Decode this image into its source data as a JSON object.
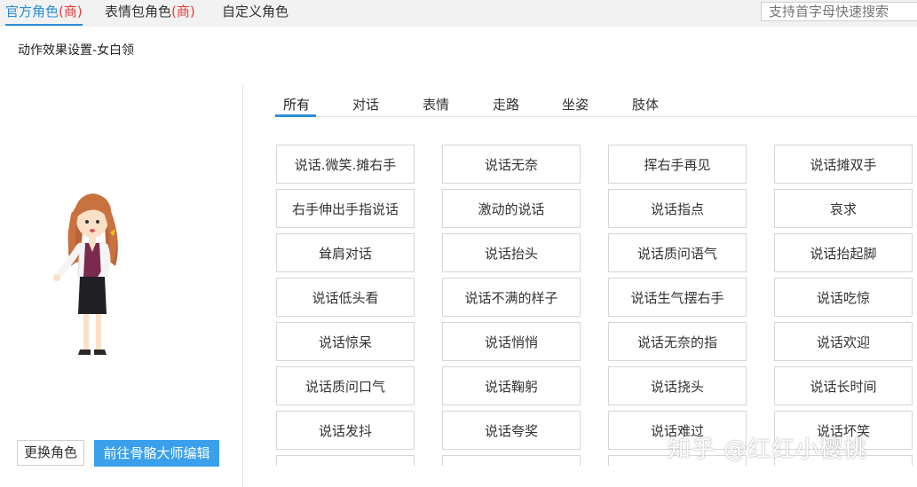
{
  "top_tabs": [
    {
      "label": "官方角色",
      "tag": "(商)",
      "active": true
    },
    {
      "label": "表情包角色",
      "tag": "(商)",
      "active": false
    },
    {
      "label": "自定义角色",
      "tag": "",
      "active": false
    }
  ],
  "search": {
    "placeholder": "支持首字母快速搜索"
  },
  "subtitle": "动作效果设置-女白领",
  "left": {
    "change_button": "更换角色",
    "go_button": "前往骨骼大师编辑",
    "avatar_icon": "cartoon-woman-character"
  },
  "categories": [
    "所有",
    "对话",
    "表情",
    "走路",
    "坐姿",
    "肢体"
  ],
  "active_category": "所有",
  "actions": [
    "说话.微笑.摊右手",
    "说话无奈",
    "挥右手再见",
    "说话摊双手",
    "右手伸出手指说话",
    "激动的说话",
    "说话指点",
    "哀求",
    "耸肩对话",
    "说话抬头",
    "说话质问语气",
    "说话抬起脚",
    "说话低头看",
    "说话不满的样子",
    "说话生气摆右手",
    "说话吃惊",
    "说话惊呆",
    "说话悄悄",
    "说话无奈的指",
    "说话欢迎",
    "说话质问口气",
    "说话鞠躬",
    "说话挠头",
    "说话长时间",
    "说话发抖",
    "说话夸奖",
    "说话难过",
    "说话坏笑",
    "",
    "",
    "",
    ""
  ],
  "watermark": "知乎 @红红小樱桃",
  "colors": {
    "accent": "#2a8ed8",
    "tag_red": "#e63c3c",
    "button_blue": "#3aa0ec"
  }
}
